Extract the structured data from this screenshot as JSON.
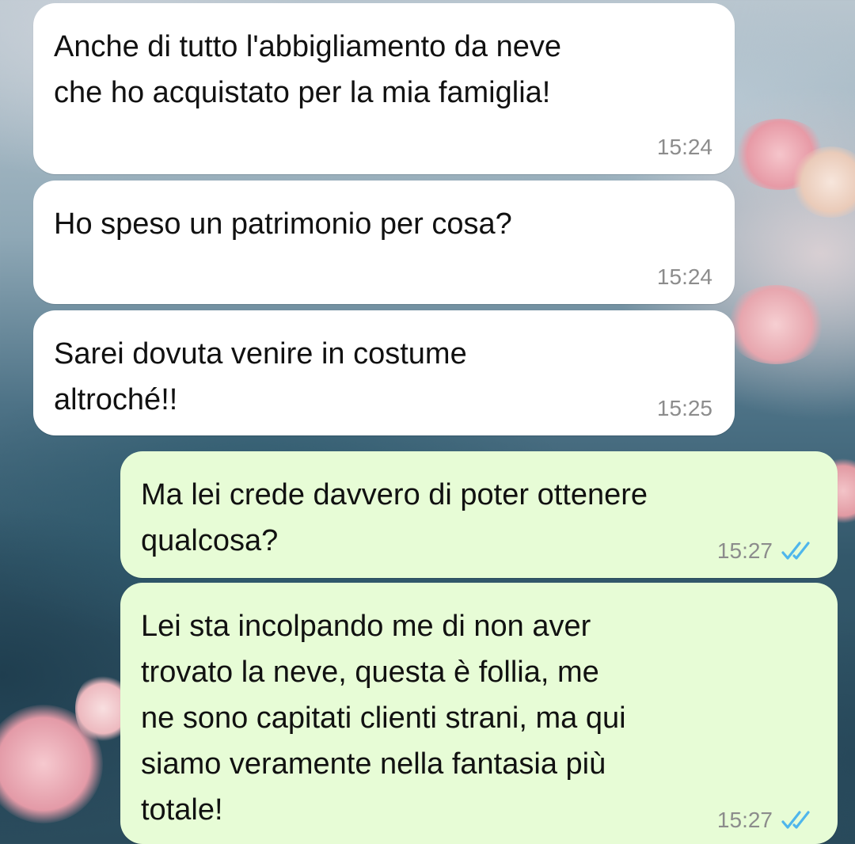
{
  "colors": {
    "incoming_bubble": "#ffffff",
    "outgoing_bubble": "#e7fcd6",
    "read_ticks": "#4fb6ec",
    "timestamp": "#8c8c8c"
  },
  "messages": [
    {
      "direction": "incoming",
      "text": "Anche di tutto l'abbigliamento da neve\nche ho acquistato per la mia famiglia!",
      "time": "15:24"
    },
    {
      "direction": "incoming",
      "text": "Ho speso un patrimonio per cosa?",
      "time": "15:24"
    },
    {
      "direction": "incoming",
      "text": "Sarei dovuta venire in costume\naltroché!!",
      "time": "15:25"
    },
    {
      "direction": "outgoing",
      "text": "Ma lei crede davvero di poter ottenere\nqualcosa?",
      "time": "15:27",
      "status_icon": "double-check-read-icon"
    },
    {
      "direction": "outgoing",
      "text": "Lei sta incolpando me di non aver\ntrovato la neve, questa è follia, me\nne sono capitati clienti strani, ma qui\nsiamo veramente nella fantasia più\ntotale!",
      "time": "15:27",
      "status_icon": "double-check-read-icon"
    }
  ]
}
